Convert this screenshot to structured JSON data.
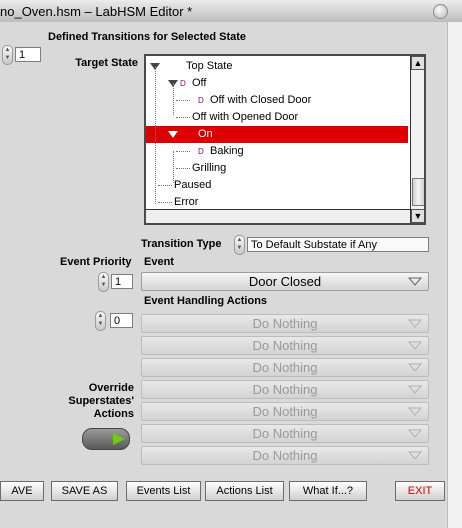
{
  "window": {
    "title": "no_Oven.hsm – LabHSM Editor *"
  },
  "left_counter": {
    "value": "1"
  },
  "section_title": "Defined Transitions for Selected State",
  "target_state": {
    "label": "Target State",
    "items": [
      {
        "label": "Top State",
        "depth": 0,
        "expanded": true,
        "default": false,
        "selected": false
      },
      {
        "label": "Off",
        "depth": 1,
        "expanded": true,
        "default": true,
        "selected": false
      },
      {
        "label": "Off with Closed Door",
        "depth": 2,
        "expanded": false,
        "default": true,
        "selected": false
      },
      {
        "label": "Off with Opened Door",
        "depth": 2,
        "expanded": false,
        "default": false,
        "selected": false
      },
      {
        "label": "On",
        "depth": 1,
        "expanded": true,
        "default": false,
        "selected": true
      },
      {
        "label": "Baking",
        "depth": 2,
        "expanded": false,
        "default": true,
        "selected": false
      },
      {
        "label": "Grilling",
        "depth": 2,
        "expanded": false,
        "default": false,
        "selected": false
      },
      {
        "label": "Paused",
        "depth": 1,
        "expanded": false,
        "default": false,
        "selected": false
      },
      {
        "label": "Error",
        "depth": 1,
        "expanded": false,
        "default": false,
        "selected": false
      }
    ],
    "default_marker": "D"
  },
  "transition_type": {
    "label": "Transition Type",
    "value": "To Default Substate if Any"
  },
  "event_priority": {
    "label": "Event Priority",
    "value": "1"
  },
  "event": {
    "label": "Event",
    "value": "Door Closed"
  },
  "event_handling": {
    "label": "Event Handling Actions",
    "index": "0",
    "actions": [
      "Do Nothing",
      "Do Nothing",
      "Do Nothing",
      "Do Nothing",
      "Do Nothing",
      "Do Nothing",
      "Do Nothing"
    ]
  },
  "override": {
    "label_lines": [
      "Override",
      "Superstates'",
      "Actions"
    ],
    "on": true
  },
  "buttons": {
    "save": "AVE",
    "save_as": "SAVE AS",
    "events_list": "Events List",
    "actions_list": "Actions List",
    "what_if": "What If...?",
    "exit": "EXIT"
  },
  "colors": {
    "selected_row": "#dd0000",
    "led_on": "#6bd000",
    "exit_text": "#d00000"
  }
}
